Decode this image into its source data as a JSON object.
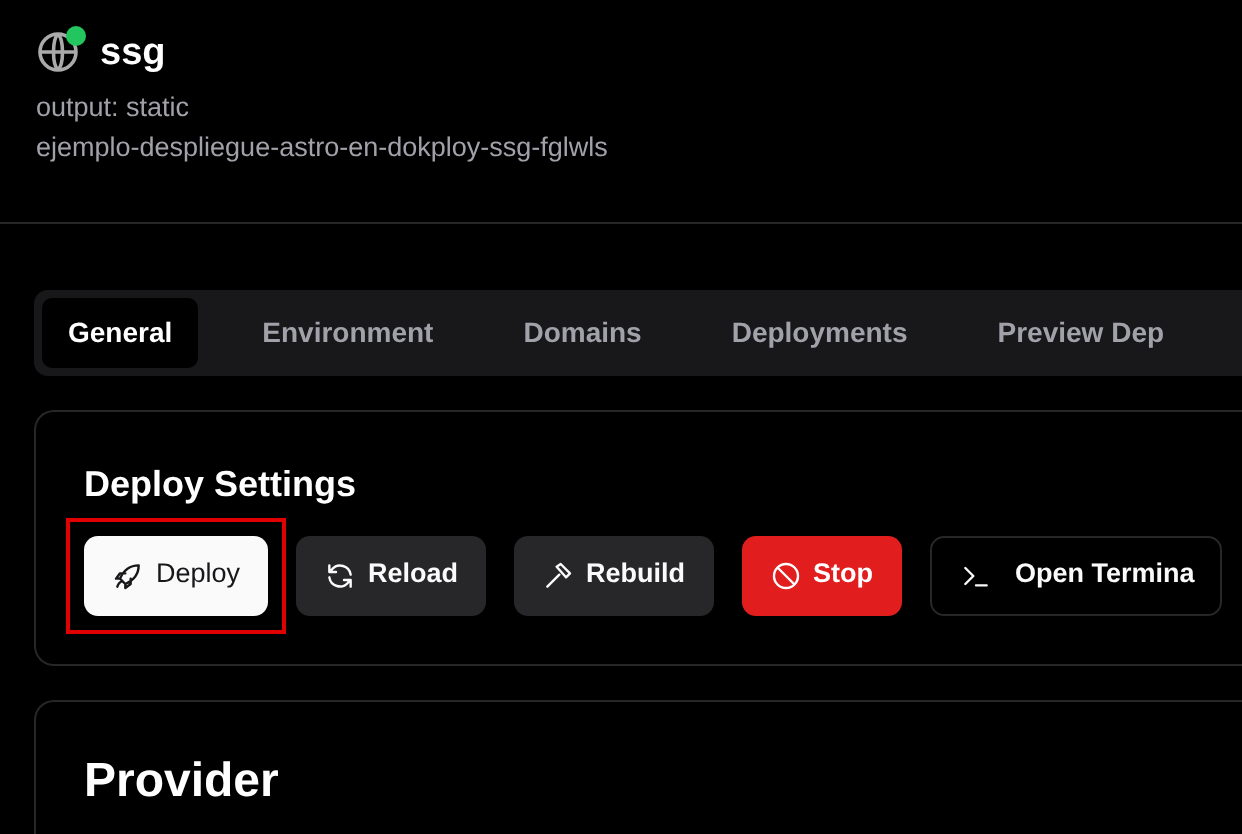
{
  "app": {
    "name": "ssg",
    "online": true,
    "subtitle": "output: static",
    "slug": "ejemplo-despliegue-astro-en-dokploy-ssg-fglwls"
  },
  "tabs": [
    {
      "label": "General",
      "selected": true
    },
    {
      "label": "Environment",
      "selected": false
    },
    {
      "label": "Domains",
      "selected": false
    },
    {
      "label": "Deployments",
      "selected": false
    },
    {
      "label": "Preview Dep",
      "selected": false
    }
  ],
  "deploy_settings": {
    "title": "Deploy Settings",
    "buttons": [
      {
        "label": "Deploy",
        "kind": "primary",
        "highlighted": true
      },
      {
        "label": "Reload",
        "kind": "secondary",
        "highlighted": false
      },
      {
        "label": "Rebuild",
        "kind": "secondary",
        "highlighted": false
      },
      {
        "label": "Stop",
        "kind": "danger",
        "highlighted": false
      },
      {
        "label": "Open Termina",
        "kind": "outline",
        "highlighted": false
      }
    ]
  },
  "provider": {
    "title": "Provider"
  }
}
